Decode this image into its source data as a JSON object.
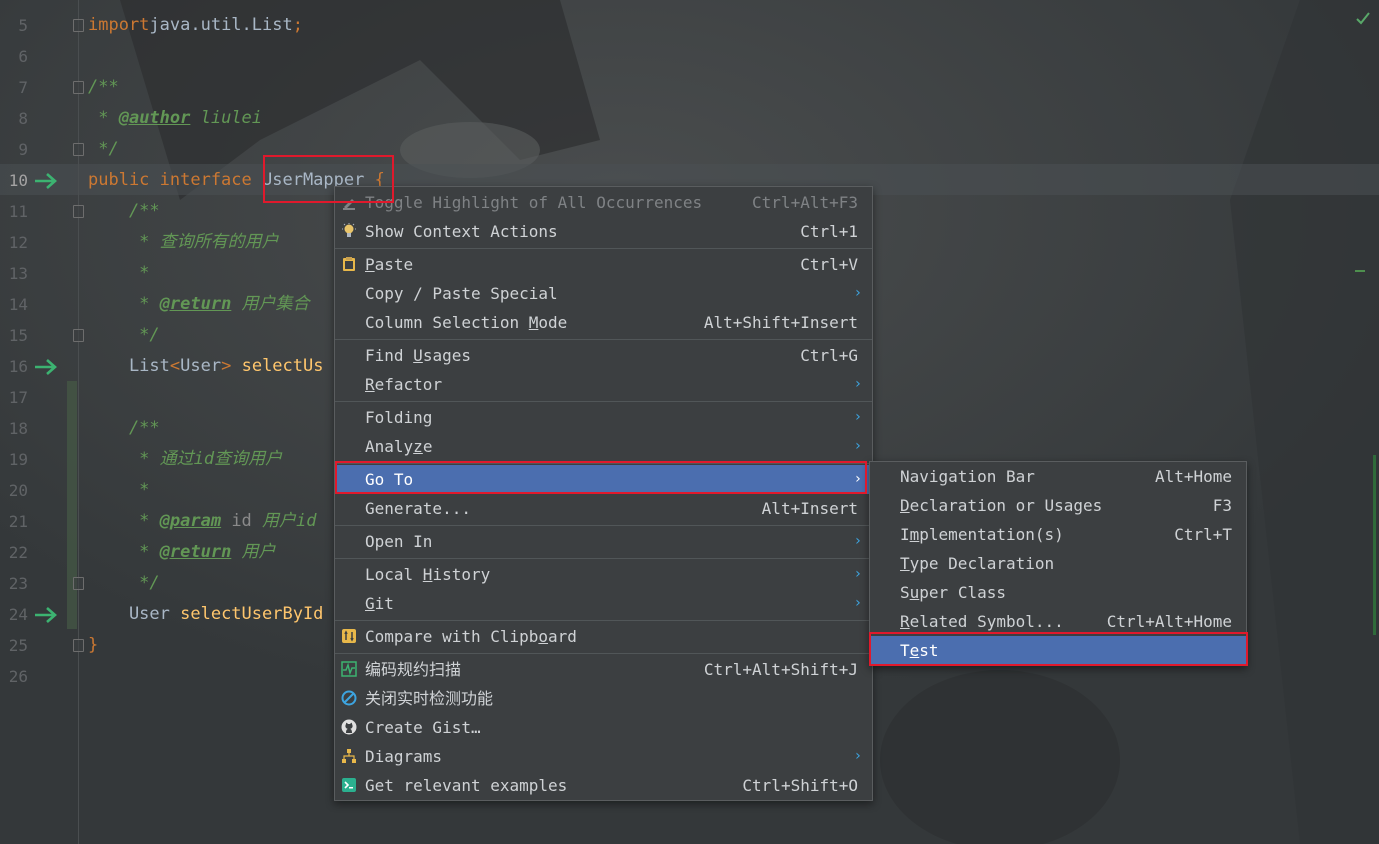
{
  "editor": {
    "lines": [
      {
        "num": "5",
        "parts": [
          [
            "kw",
            "import"
          ],
          [
            "",
            "java.util.List"
          ],
          [
            "kw",
            ";"
          ]
        ]
      },
      {
        "num": "6",
        "parts": []
      },
      {
        "num": "7",
        "parts": [
          [
            "cm",
            "/**"
          ]
        ]
      },
      {
        "num": "8",
        "parts": [
          [
            "cm",
            " * "
          ],
          [
            "tag",
            "@author"
          ],
          [
            "cm",
            " liulei"
          ]
        ]
      },
      {
        "num": "9",
        "parts": [
          [
            "cm",
            " */"
          ]
        ]
      },
      {
        "num": "10",
        "parts": [
          [
            "kw",
            "public interface "
          ],
          [
            "",
            "UserMapper"
          ],
          [
            "kw",
            " {"
          ]
        ]
      },
      {
        "num": "11",
        "parts": [
          [
            "cm",
            "    /**"
          ]
        ]
      },
      {
        "num": "12",
        "parts": [
          [
            "cm",
            "     * 查询所有的用户"
          ]
        ]
      },
      {
        "num": "13",
        "parts": [
          [
            "cm",
            "     *"
          ]
        ]
      },
      {
        "num": "14",
        "parts": [
          [
            "cm",
            "     * "
          ],
          [
            "tag",
            "@return"
          ],
          [
            "cm",
            " 用户集合"
          ]
        ]
      },
      {
        "num": "15",
        "parts": [
          [
            "cm",
            "     */"
          ]
        ]
      },
      {
        "num": "16",
        "parts": [
          [
            "",
            "    List"
          ],
          [
            "kw",
            "<"
          ],
          [
            "",
            "User"
          ],
          [
            "kw",
            ">"
          ],
          [
            "",
            " "
          ],
          [
            "fn",
            "selectUs"
          ]
        ]
      },
      {
        "num": "17",
        "parts": []
      },
      {
        "num": "18",
        "parts": [
          [
            "cm",
            "    /**"
          ]
        ]
      },
      {
        "num": "19",
        "parts": [
          [
            "cm",
            "     * 通过id查询用户"
          ]
        ]
      },
      {
        "num": "20",
        "parts": [
          [
            "cm",
            "     *"
          ]
        ]
      },
      {
        "num": "21",
        "parts": [
          [
            "cm",
            "     * "
          ],
          [
            "tag",
            "@param"
          ],
          [
            "pm",
            " id"
          ],
          [
            "cm",
            " 用户id"
          ]
        ]
      },
      {
        "num": "22",
        "parts": [
          [
            "cm",
            "     * "
          ],
          [
            "tag",
            "@return"
          ],
          [
            "cm",
            " 用户"
          ]
        ]
      },
      {
        "num": "23",
        "parts": [
          [
            "cm",
            "     */"
          ]
        ]
      },
      {
        "num": "24",
        "parts": [
          [
            "",
            "    User "
          ],
          [
            "fn",
            "selectUserById"
          ]
        ]
      },
      {
        "num": "25",
        "parts": [
          [
            "kw",
            "}"
          ]
        ]
      },
      {
        "num": "26",
        "parts": []
      }
    ],
    "current_line": "10",
    "gutter_arrows": [
      "10",
      "16",
      "24"
    ],
    "highlighted_symbol": "UserMapper"
  },
  "context_menu": {
    "items": [
      {
        "label": "Toggle Highlight of All Occurrences",
        "shortcut": "Ctrl+Alt+F3",
        "disabled": true,
        "icon": "highlight-icon"
      },
      {
        "label": "Show Context Actions",
        "shortcut": "Ctrl+1",
        "icon": "lightbulb-icon"
      },
      {
        "sep": true
      },
      {
        "label": "Paste",
        "u": 0,
        "shortcut": "Ctrl+V",
        "icon": "clipboard-icon"
      },
      {
        "label": "Copy / Paste Special",
        "submenu": true
      },
      {
        "label": "Column Selection Mode",
        "u": 17,
        "shortcut": "Alt+Shift+Insert"
      },
      {
        "sep": true
      },
      {
        "label": "Find Usages",
        "u": 5,
        "shortcut": "Ctrl+G"
      },
      {
        "label": "Refactor",
        "u": 0,
        "submenu": true
      },
      {
        "sep": true
      },
      {
        "label": "Folding",
        "submenu": true
      },
      {
        "label": "Analyze",
        "u": 5,
        "submenu": true
      },
      {
        "sep": true
      },
      {
        "label": "Go To",
        "submenu": true,
        "selected": true
      },
      {
        "label": "Generate...",
        "shortcut": "Alt+Insert"
      },
      {
        "sep": true
      },
      {
        "label": "Open In",
        "submenu": true
      },
      {
        "sep": true
      },
      {
        "label": "Local History",
        "u": 6,
        "submenu": true
      },
      {
        "label": "Git",
        "u": 0,
        "submenu": true
      },
      {
        "sep": true
      },
      {
        "label": "Compare with Clipboard",
        "u": 18,
        "icon": "compare-icon"
      },
      {
        "sep": true
      },
      {
        "label": "编码规约扫描",
        "shortcut": "Ctrl+Alt+Shift+J",
        "icon": "scan-icon"
      },
      {
        "label": "关闭实时检测功能",
        "icon": "no-entry-icon"
      },
      {
        "label": "Create Gist…",
        "icon": "github-icon"
      },
      {
        "label": "Diagrams",
        "submenu": true,
        "icon": "diagram-icon"
      },
      {
        "label": "Get relevant examples",
        "shortcut": "Ctrl+Shift+O",
        "icon": "examples-icon"
      }
    ]
  },
  "goto_submenu": {
    "items": [
      {
        "label": "Navigation Bar",
        "shortcut": "Alt+Home"
      },
      {
        "label": "Declaration or Usages",
        "u": 0,
        "shortcut": "F3"
      },
      {
        "label": "Implementation(s)",
        "u": 1,
        "shortcut": "Ctrl+T"
      },
      {
        "label": "Type Declaration",
        "u": 0
      },
      {
        "label": "Super Class",
        "u": 1
      },
      {
        "label": "Related Symbol...",
        "u": 0,
        "shortcut": "Ctrl+Alt+Home"
      },
      {
        "label": "Test",
        "u": 1,
        "selected": true
      }
    ]
  },
  "colors": {
    "menu_bg": "#3c3f41",
    "selection": "#4b6eaf",
    "highlight_box": "#e0192c",
    "submenu_arrow": "#3da4e0"
  }
}
